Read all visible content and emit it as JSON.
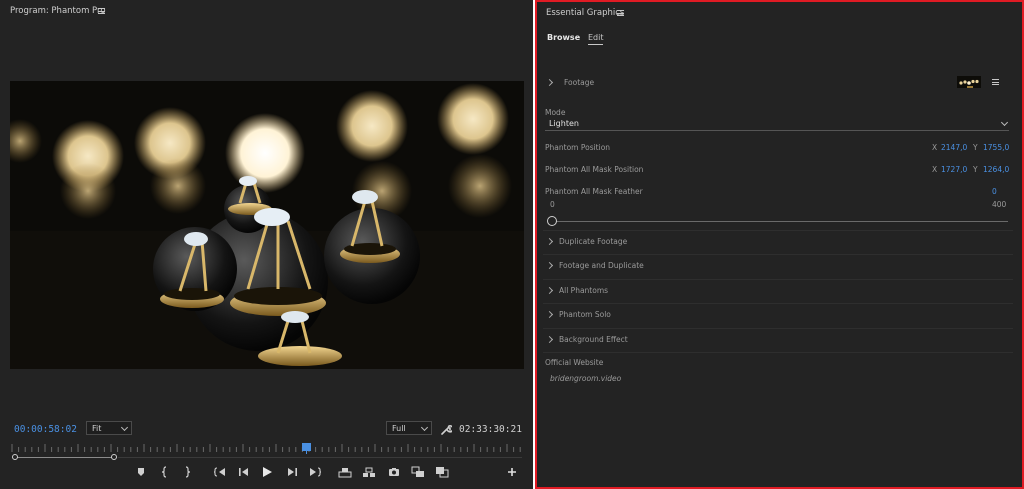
{
  "program_monitor": {
    "title": "Program: Phantom Pro",
    "timecode": "00:00:58:02",
    "fit_select": "Fit",
    "quality_select": "Full",
    "duration": "02:33:30:21",
    "transport_icons": [
      "add-marker-icon",
      "mark-in-icon",
      "mark-out-icon",
      "go-to-in-icon",
      "step-back-icon",
      "play-icon",
      "step-forward-icon",
      "go-to-out-icon",
      "lift-icon",
      "extract-icon",
      "export-frame-icon",
      "insert-icon",
      "overwrite-icon",
      "plus-icon"
    ]
  },
  "essential_graphics": {
    "title": "Essential Graphics",
    "tabs": {
      "browse": "Browse",
      "edit": "Edit"
    },
    "footage_label": "Footage",
    "mode": {
      "label": "Mode",
      "value": "Lighten"
    },
    "phantom_position": {
      "label": "Phantom Position",
      "x_label": "X",
      "x": "2147,0",
      "y_label": "Y",
      "y": "1755,0"
    },
    "mask_position": {
      "label": "Phantom All Mask Position",
      "x_label": "X",
      "x": "1727,0",
      "y_label": "Y",
      "y": "1264,0"
    },
    "mask_feather": {
      "label": "Phantom All Mask Feather",
      "value": "0",
      "min": "0",
      "max": "400",
      "level": 0
    },
    "sections": [
      "Duplicate Footage",
      "Footage and Duplicate",
      "All Phantoms",
      "Phantom Solo",
      "Background Effect"
    ],
    "website": {
      "label": "Official Website",
      "url": "bridengroom.video"
    }
  },
  "colors": {
    "accent_blue": "#4a90e2",
    "highlight_border": "#e01b24",
    "panel_bg": "#232323"
  }
}
